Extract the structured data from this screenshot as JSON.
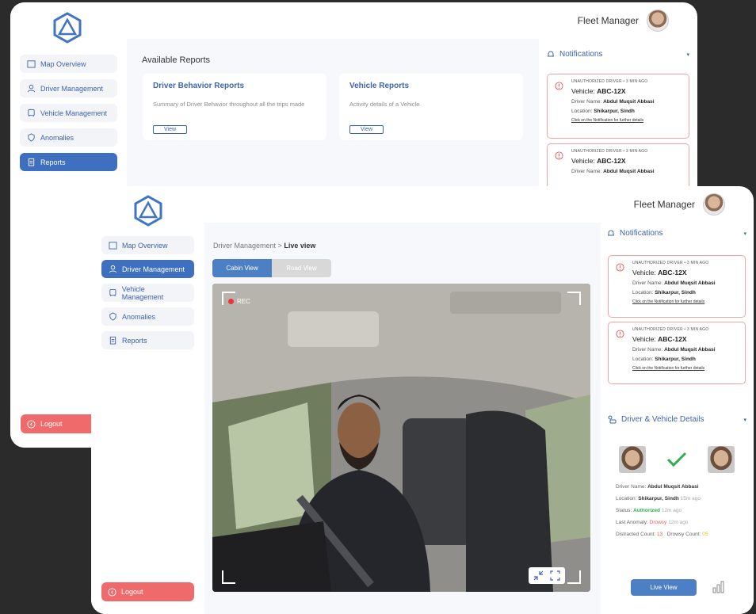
{
  "app": {
    "user_name": "Fleet Manager"
  },
  "nav": {
    "items": [
      {
        "label": "Map Overview",
        "icon": "map-icon"
      },
      {
        "label": "Driver Management",
        "icon": "user-icon"
      },
      {
        "label": "Vehicle Management",
        "icon": "bus-icon"
      },
      {
        "label": "Anomalies",
        "icon": "shield-icon"
      },
      {
        "label": "Reports",
        "icon": "clipboard-icon"
      }
    ],
    "logout": "Logout"
  },
  "reports_page": {
    "title": "Available Reports",
    "cards": [
      {
        "title": "Driver Behavior Reports",
        "desc": "Summary of Driver Behavior throughout all the trips made",
        "button": "View"
      },
      {
        "title": "Vehicle Reports",
        "desc": "Activity details of a Vehicle",
        "button": "View"
      }
    ]
  },
  "notifications": {
    "title": "Notifications",
    "items": [
      {
        "tag": "UNAUTHORIZED DRIVER  •  3 MIN AGO",
        "vehicle_prefix": "Vehicle:",
        "vehicle": "ABC-12X",
        "driver_prefix": "Driver Name:",
        "driver": "Abdul Muqsit Abbasi",
        "location_prefix": "Location:",
        "location": "Shikarpur, Sindh",
        "link": "Click on the Notification for further details"
      },
      {
        "tag": "UNAUTHORIZED DRIVER  •  3 MIN AGO",
        "vehicle_prefix": "Vehicle:",
        "vehicle": "ABC-12X",
        "driver_prefix": "Driver Name:",
        "driver": "Abdul Muqsit Abbasi",
        "location_prefix": "Location:",
        "location": "Shikarpur, Sindh",
        "link": "Click on the Notification for further details"
      }
    ]
  },
  "live_page": {
    "breadcrumb_parent": "Driver Management",
    "breadcrumb_sep": ">",
    "breadcrumb_current": "Live view",
    "tabs": [
      "Cabin View",
      "Road View"
    ],
    "rec_label": "REC"
  },
  "driver_vehicle": {
    "title": "Driver & Vehicle Details",
    "driver_label": "Driver Name:",
    "driver": "Abdul Muqsit Abbasi",
    "location_label": "Location:",
    "location": "Shikarpur, Sindh",
    "location_time": "15m ago",
    "status_label": "Status:",
    "status": "Authorized",
    "status_time": "12m ago",
    "anomaly_label": "Last Anomaly:",
    "anomaly": "Drowsy",
    "anomaly_time": "12m ago",
    "distracted_label": "Distracted Count:",
    "distracted": "13",
    "drowsy_label": "Drowsy Count:",
    "drowsy": "05",
    "live_button": "Live View"
  },
  "colors": {
    "primary": "#3f6fbf",
    "danger": "#ef6b6b",
    "success": "#2eae4f",
    "warning": "#e0c020"
  }
}
